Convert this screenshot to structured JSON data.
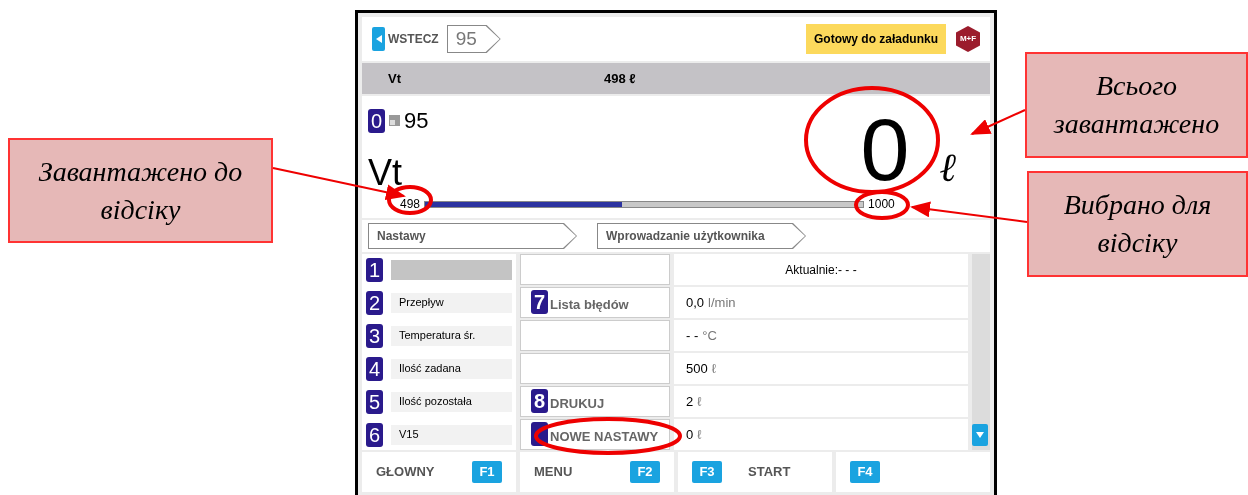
{
  "screen": {
    "back_button": "WSTECZ",
    "path_step": "95",
    "status": "Gotowy do załadunku",
    "logo": "M+F",
    "summary": {
      "name": "Vt",
      "value": "498 ℓ"
    },
    "compartment": {
      "key": "0",
      "number": "95",
      "name": "Vt",
      "total": "0",
      "unit": "ℓ",
      "loaded": "498",
      "level": 0.45,
      "selected": "1000"
    },
    "breadcrumbs": [
      "Nastawy",
      "Wprowadzanie użytkownika"
    ],
    "rows": [
      {
        "key": "1"
      },
      {
        "key": "2",
        "label": "Przepływ"
      },
      {
        "key": "3",
        "label": "Temperatura śr."
      },
      {
        "key": "4",
        "label": "Ilość zadana"
      },
      {
        "key": "5",
        "label": "Ilość pozostała"
      },
      {
        "key": "6",
        "label": "V15"
      }
    ],
    "actions": [
      {
        "kind": "empty"
      },
      {
        "kind": "action",
        "key": "7",
        "label": "Lista błędów"
      },
      {
        "kind": "empty"
      },
      {
        "kind": "empty"
      },
      {
        "kind": "action",
        "key": "8",
        "label": "DRUKUJ"
      },
      {
        "kind": "action",
        "label": "NOWE NASTAWY"
      }
    ],
    "values": [
      {
        "kind": "header",
        "text": "Aktualnie:- - -"
      },
      {
        "kind": "value",
        "text": "0,0",
        "unit": "l/min"
      },
      {
        "kind": "value",
        "text": "- -",
        "unit": "°C"
      },
      {
        "kind": "value",
        "text": "500",
        "unit": "ℓ"
      },
      {
        "kind": "value",
        "text": "2",
        "unit": "ℓ"
      },
      {
        "kind": "value",
        "text": "0",
        "unit": "ℓ"
      }
    ],
    "function_keys": [
      {
        "kind": "label-first",
        "label": "GŁOWNY",
        "key": "F1"
      },
      {
        "kind": "label-first",
        "label": "MENU",
        "key": "F2"
      },
      {
        "kind": "key-first",
        "label": "START",
        "key": "F3"
      },
      {
        "kind": "key-first",
        "key": "F4"
      }
    ]
  },
  "callouts": [
    {
      "text": "Завантажено до відсіку"
    },
    {
      "text": "Всього завантажено"
    },
    {
      "text": "Вибрано для відсіку"
    }
  ]
}
